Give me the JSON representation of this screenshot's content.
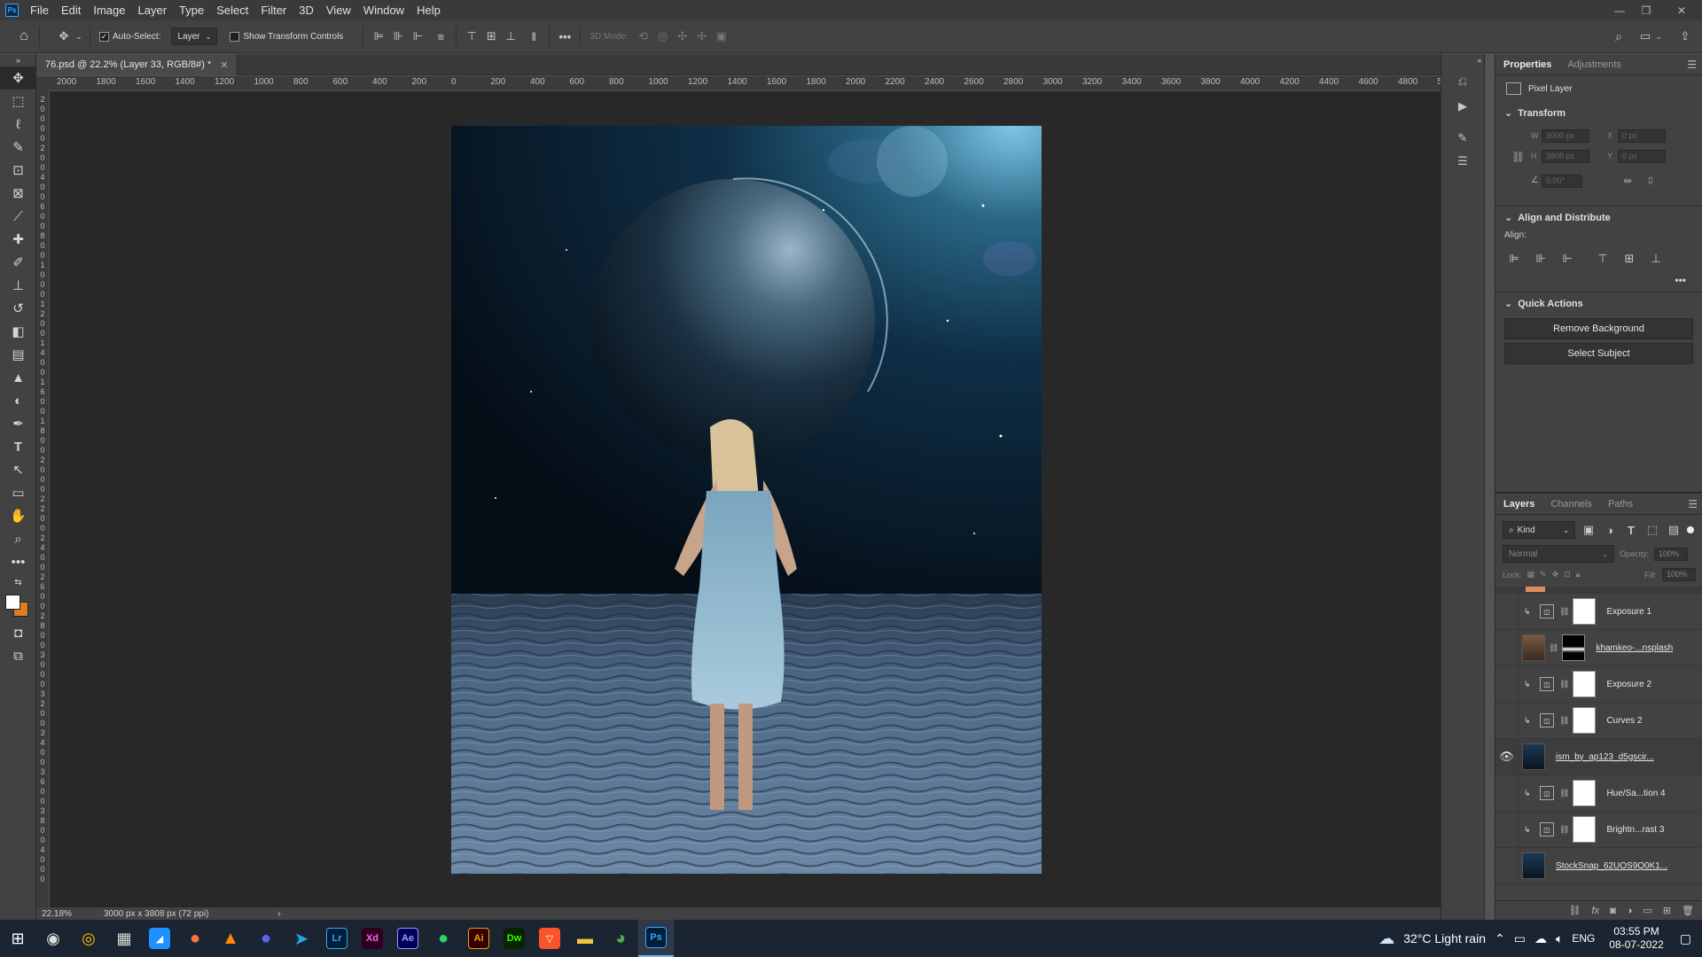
{
  "app": {
    "logo": "Ps"
  },
  "menu": [
    "File",
    "Edit",
    "Image",
    "Layer",
    "Type",
    "Select",
    "Filter",
    "3D",
    "View",
    "Window",
    "Help"
  ],
  "options": {
    "auto_select_label": "Auto-Select:",
    "auto_select_checked": true,
    "target_value": "Layer",
    "show_transform_label": "Show Transform Controls",
    "mode_3d_label": "3D Mode:"
  },
  "document": {
    "tab_title": "76.psd @ 22.2% (Layer 33, RGB/8#) *",
    "zoom": "22.18%",
    "size_info": "3000 px x 3808 px (72 ppi)"
  },
  "ruler": {
    "top": [
      "2000",
      "1800",
      "1600",
      "1400",
      "1200",
      "1000",
      "800",
      "600",
      "400",
      "200",
      "0",
      "200",
      "400",
      "600",
      "800",
      "1000",
      "1200",
      "1400",
      "1600",
      "1800",
      "2000",
      "2200",
      "2400",
      "2600",
      "2800",
      "3000",
      "3200",
      "3400",
      "3600",
      "3800",
      "4000",
      "4200",
      "4400",
      "4600",
      "4800",
      "5"
    ],
    "left": [
      "2",
      "0",
      "0",
      "0",
      "0",
      "2",
      "0",
      "0",
      "4",
      "0",
      "0",
      "6",
      "0",
      "0",
      "8",
      "0",
      "0",
      "1",
      "0",
      "0",
      "0",
      "1",
      "2",
      "0",
      "0",
      "1",
      "4",
      "0",
      "0",
      "1",
      "6",
      "0",
      "0",
      "1",
      "8",
      "0",
      "0",
      "2",
      "0",
      "0",
      "0",
      "2",
      "2",
      "0",
      "0",
      "2",
      "4",
      "0",
      "0",
      "2",
      "6",
      "0",
      "0",
      "2",
      "8",
      "0",
      "0",
      "3",
      "0",
      "0",
      "0",
      "3",
      "2",
      "0",
      "0",
      "3",
      "4",
      "0",
      "0",
      "3",
      "6",
      "0",
      "0",
      "3",
      "8",
      "0",
      "0",
      "4",
      "0",
      "0",
      "0"
    ]
  },
  "properties": {
    "tabs": [
      "Properties",
      "Adjustments"
    ],
    "layer_type": "Pixel Layer",
    "transform_title": "Transform",
    "w_label": "W",
    "w_value": "3000 px",
    "h_label": "H",
    "h_value": "3808 px",
    "x_label": "X",
    "x_value": "0 px",
    "y_label": "Y",
    "y_value": "0 px",
    "angle_value": "0.00°",
    "align_title": "Align and Distribute",
    "align_label": "Align:",
    "quick_title": "Quick Actions",
    "remove_bg": "Remove Background",
    "select_subject": "Select Subject"
  },
  "layers_panel": {
    "tabs": [
      "Layers",
      "Channels",
      "Paths"
    ],
    "filter_kind": "Kind",
    "blend_mode": "Normal",
    "opacity_label": "Opacity:",
    "opacity_value": "100%",
    "lock_label": "Lock:",
    "fill_label": "Fill:",
    "fill_value": "100%",
    "layers": [
      {
        "name": "Exposure 1",
        "type": "adjustment",
        "visible": false
      },
      {
        "name": "khamkeo-...nsplash",
        "type": "smart",
        "visible": false
      },
      {
        "name": "Exposure 2",
        "type": "adjustment",
        "visible": false
      },
      {
        "name": "Curves 2",
        "type": "adjustment",
        "visible": false
      },
      {
        "name": "ism_by_ap123_d5gscir...",
        "type": "smart",
        "visible": true
      },
      {
        "name": "Hue/Sa...tion 4",
        "type": "adjustment",
        "visible": false
      },
      {
        "name": "Brightn...rast 3",
        "type": "adjustment",
        "visible": false
      },
      {
        "name": "StockSnap_62UOS9Q0K1...",
        "type": "smart",
        "visible": false
      }
    ]
  },
  "taskbar": {
    "weather": "32°C  Light rain",
    "language": "ENG",
    "time": "03:55 PM",
    "date": "08-07-2022",
    "apps": [
      {
        "label": "Lr",
        "color": "#31a8ff",
        "bg": "#001e36"
      },
      {
        "label": "Xd",
        "color": "#ff61f6",
        "bg": "#2e001e"
      },
      {
        "label": "Ae",
        "color": "#9999ff",
        "bg": "#00005b"
      },
      {
        "label": "Ai",
        "color": "#ff9a00",
        "bg": "#330000"
      },
      {
        "label": "Dw",
        "color": "#35fa00",
        "bg": "#072401"
      },
      {
        "label": "Ps",
        "color": "#31a8ff",
        "bg": "#001e36"
      }
    ]
  }
}
